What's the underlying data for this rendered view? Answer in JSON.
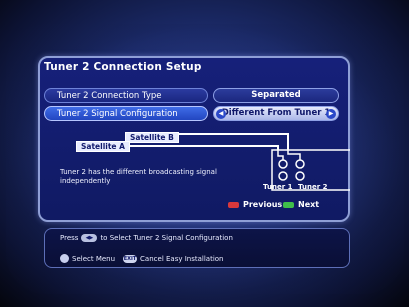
{
  "panel": {
    "title": "Tuner 2 Connection Setup"
  },
  "rows": [
    {
      "label": "Tuner 2 Connection Type",
      "value": "Separated"
    },
    {
      "label": "Tuner 2 Signal Configuration",
      "value": "Different From Tuner 1"
    }
  ],
  "diagram": {
    "satellite_a": "Satellite A",
    "satellite_b": "Satellite B",
    "description": "Tuner 2 has the different broadcasting signal independently",
    "tuner1": "Tuner 1",
    "tuner2": "Tuner 2"
  },
  "nav": {
    "previous": "Previous",
    "next": "Next",
    "previous_color": "#d8383c",
    "next_color": "#3fbf4a"
  },
  "help": {
    "press": "Press",
    "press_action": "to Select Tuner 2 Signal Configuration",
    "select_menu": "Select Menu",
    "exit_key": "EXIT",
    "cancel": "Cancel Easy Installation"
  },
  "icons": {
    "left_right_arrows": "left-right-arrows-icon",
    "select_dial": "select-dial-icon"
  }
}
